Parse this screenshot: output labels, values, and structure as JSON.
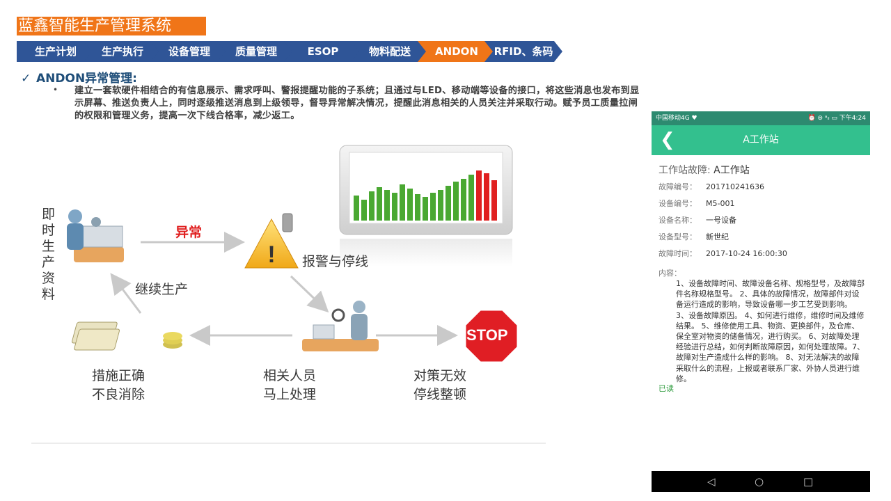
{
  "header": {
    "title": "蓝鑫智能生产管理系统"
  },
  "nav": {
    "items": [
      {
        "label": "生产计划",
        "active": false
      },
      {
        "label": "生产执行",
        "active": false
      },
      {
        "label": "设备管理",
        "active": false
      },
      {
        "label": "质量管理",
        "active": false
      },
      {
        "label": "ESOP",
        "active": false
      },
      {
        "label": "物料配送",
        "active": false
      },
      {
        "label": "ANDON",
        "active": true
      },
      {
        "label": "RFID、条码",
        "active": false
      }
    ],
    "colors": {
      "normal": "#2f5597",
      "active": "#f07518"
    }
  },
  "section": {
    "heading": "ANDON异常管理:",
    "bullet": "•",
    "paragraph": "建立一套软硬件相结合的有信息展示、需求呼叫、警报提醒功能的子系统；且通过与LED、移动端等设备的接口，将这些消息也发布到显示屏幕、推送负责人上，同时逐级推送消息到上级领导，督导异常解决情况，提醒此消息相关的人员关注并采取行动。赋予员工质量拉闸的权限和管理义务，提高一次下线合格率，减少返工。"
  },
  "diagram": {
    "vertical_label": [
      "即",
      "时",
      "生",
      "产",
      "资",
      "料"
    ],
    "abnormal": "异常",
    "alarm": "报警与停线",
    "continue": "继续生产",
    "stop_sign": "STOP",
    "measures": [
      "措施正确",
      "不良消除"
    ],
    "staff": [
      "相关人员",
      "马上处理"
    ],
    "countermeasure": [
      "对策无效",
      "停线整顿"
    ],
    "icons": [
      "worker-station-icon",
      "warning-phone-icon",
      "dashboard-chart-icon",
      "inspector-icon",
      "money-stack-icon",
      "stop-sign-icon"
    ]
  },
  "phone": {
    "status_left": "中国移动4G ♥",
    "status_right": "⏰ ⊜ ᵃᵢₗ ▭ 下午4:24",
    "title": "A工作站",
    "heading_key": "工作站故障:",
    "heading_value": "A工作站",
    "fields": [
      {
        "key": "故障编号：",
        "value": "201710241636"
      },
      {
        "key": "设备编号：",
        "value": "M5-001"
      },
      {
        "key": "设备名称：",
        "value": "一号设备"
      },
      {
        "key": "设备型号：",
        "value": "新世纪"
      },
      {
        "key": "故障时间：",
        "value": "2017-10-24 16:00:30"
      }
    ],
    "content_label": "内容：",
    "content": "1、设备故障时间、故障设备名称、规格型号，及故障部件名称规格型号。 2、具体的故障情况，故障部件对设备运行造成的影响，导致设备哪一步工艺受到影响。 3、设备故障原因。 4、如何进行维修，维修时间及维修结果。 5、维修使用工具、物资、更换部件，及仓库、保全室对物资的储备情况，进行购买。 6、对故障处理经验进行总结，如何判断故障原因，如何处理故障。7、故障对生产造成什么样的影响。 8、对无法解决的故障采取什么的流程，上报或者联系厂家、外协人员进行维修。",
    "read_status": "已读",
    "nav_buttons": [
      "◁",
      "○",
      "□"
    ]
  }
}
